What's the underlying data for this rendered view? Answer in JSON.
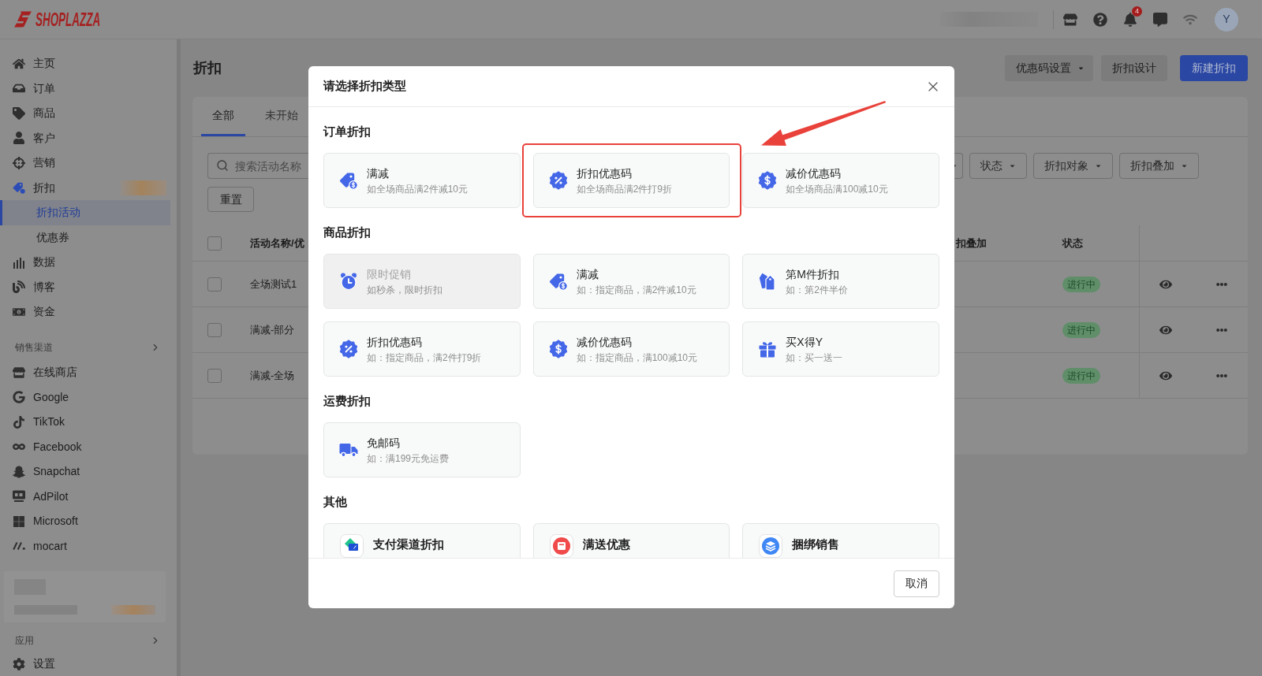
{
  "top_bar": {
    "logo_text": "SHOPLAZZA",
    "notification_count": "4",
    "avatar_initial": "Y"
  },
  "sidebar": {
    "items": [
      {
        "label": "主页",
        "selected": false
      },
      {
        "label": "订单",
        "selected": false
      },
      {
        "label": "商品",
        "selected": false
      },
      {
        "label": "客户",
        "selected": false
      },
      {
        "label": "营销",
        "selected": false
      },
      {
        "label": "折扣",
        "selected": false,
        "expanded": true,
        "children": [
          {
            "label": "折扣活动",
            "selected": true
          },
          {
            "label": "优惠券",
            "selected": false
          }
        ]
      },
      {
        "label": "数据",
        "selected": false
      },
      {
        "label": "博客",
        "selected": false
      },
      {
        "label": "资金",
        "selected": false
      }
    ],
    "sales_channels": {
      "title": "销售渠道",
      "items": [
        {
          "label": "在线商店",
          "selected": false
        },
        {
          "label": "Google",
          "selected": false
        },
        {
          "label": "TikTok",
          "selected": false
        },
        {
          "label": "Facebook",
          "selected": false
        },
        {
          "label": "Snapchat",
          "selected": false
        },
        {
          "label": "AdPilot",
          "selected": false
        },
        {
          "label": "Microsoft",
          "selected": false
        },
        {
          "label": "mocart",
          "selected": false
        }
      ]
    },
    "apps": {
      "title": "应用"
    },
    "settings": {
      "label": "设置",
      "selected": false
    }
  },
  "page": {
    "title": "折扣",
    "buttons": [
      {
        "label": "优惠码设置",
        "kind": "dropdown"
      },
      {
        "label": "折扣设计",
        "kind": "secondary"
      },
      {
        "label": "新建折扣",
        "kind": "primary"
      }
    ],
    "tabs": [
      {
        "label": "全部",
        "selected": true
      },
      {
        "label": "未开始",
        "selected": false
      }
    ],
    "search": {
      "placeholder": "搜索活动名称"
    },
    "filters": [
      {
        "label": "状态"
      },
      {
        "label": "折扣对象"
      },
      {
        "label": "折扣叠加"
      }
    ],
    "reset_button": "重置",
    "table": {
      "header_checked": false,
      "columns": [
        {
          "label": "活动名称/优"
        },
        {
          "label": "扣叠加"
        },
        {
          "label": "状态"
        }
      ],
      "rows": [
        {
          "checked": false,
          "name": "全场测试1",
          "status": "进行中"
        },
        {
          "checked": false,
          "name": "满减-部分",
          "status": "进行中"
        },
        {
          "checked": false,
          "name": "满减-全场",
          "status": "进行中"
        }
      ]
    }
  },
  "modal": {
    "title": "请选择折扣类型",
    "sections": [
      {
        "title": "订单折扣",
        "kind": "standard",
        "options": [
          {
            "title": "满减",
            "description": "如全场商品满2件减10元",
            "disabled": false,
            "highlighted": false
          },
          {
            "title": "折扣优惠码",
            "description": "如全场商品满2件打9折",
            "disabled": false,
            "highlighted": true
          },
          {
            "title": "减价优惠码",
            "description": "如全场商品满100减10元",
            "disabled": false,
            "highlighted": false
          }
        ]
      },
      {
        "title": "商品折扣",
        "kind": "standard",
        "options": [
          {
            "title": "限时促销",
            "description": "如秒杀，限时折扣",
            "disabled": true,
            "highlighted": false
          },
          {
            "title": "满减",
            "description": "如：指定商品，满2件减10元",
            "disabled": false,
            "highlighted": false
          },
          {
            "title": "第M件折扣",
            "description": "如：第2件半价",
            "disabled": false,
            "highlighted": false
          },
          {
            "title": "折扣优惠码",
            "description": "如：指定商品，满2件打9折",
            "disabled": false,
            "highlighted": false
          },
          {
            "title": "减价优惠码",
            "description": "如：指定商品，满100减10元",
            "disabled": false,
            "highlighted": false
          },
          {
            "title": "买X得Y",
            "description": "如：买一送一",
            "disabled": false,
            "highlighted": false
          }
        ]
      },
      {
        "title": "运费折扣",
        "kind": "standard",
        "options": [
          {
            "title": "免邮码",
            "description": "如：满199元免运费",
            "disabled": false,
            "highlighted": false
          }
        ]
      },
      {
        "title": "其他",
        "kind": "partial",
        "options": [
          {
            "title": "支付渠道折扣",
            "disabled": false,
            "highlighted": false
          },
          {
            "title": "满送优惠",
            "disabled": false,
            "highlighted": false
          },
          {
            "title": "捆绑销售",
            "disabled": false,
            "highlighted": false
          }
        ]
      }
    ],
    "cancel_button": "取消"
  }
}
